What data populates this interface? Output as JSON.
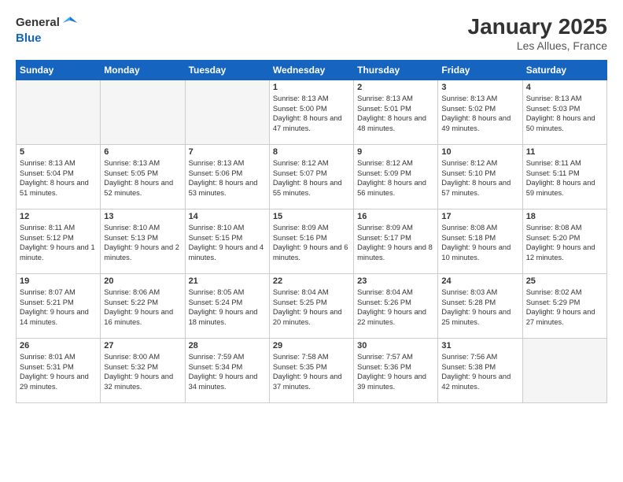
{
  "header": {
    "logo_general": "General",
    "logo_blue": "Blue",
    "month_title": "January 2025",
    "location": "Les Allues, France"
  },
  "weekdays": [
    "Sunday",
    "Monday",
    "Tuesday",
    "Wednesday",
    "Thursday",
    "Friday",
    "Saturday"
  ],
  "weeks": [
    [
      {
        "day": "",
        "text": ""
      },
      {
        "day": "",
        "text": ""
      },
      {
        "day": "",
        "text": ""
      },
      {
        "day": "1",
        "text": "Sunrise: 8:13 AM\nSunset: 5:00 PM\nDaylight: 8 hours and 47 minutes."
      },
      {
        "day": "2",
        "text": "Sunrise: 8:13 AM\nSunset: 5:01 PM\nDaylight: 8 hours and 48 minutes."
      },
      {
        "day": "3",
        "text": "Sunrise: 8:13 AM\nSunset: 5:02 PM\nDaylight: 8 hours and 49 minutes."
      },
      {
        "day": "4",
        "text": "Sunrise: 8:13 AM\nSunset: 5:03 PM\nDaylight: 8 hours and 50 minutes."
      }
    ],
    [
      {
        "day": "5",
        "text": "Sunrise: 8:13 AM\nSunset: 5:04 PM\nDaylight: 8 hours and 51 minutes."
      },
      {
        "day": "6",
        "text": "Sunrise: 8:13 AM\nSunset: 5:05 PM\nDaylight: 8 hours and 52 minutes."
      },
      {
        "day": "7",
        "text": "Sunrise: 8:13 AM\nSunset: 5:06 PM\nDaylight: 8 hours and 53 minutes."
      },
      {
        "day": "8",
        "text": "Sunrise: 8:12 AM\nSunset: 5:07 PM\nDaylight: 8 hours and 55 minutes."
      },
      {
        "day": "9",
        "text": "Sunrise: 8:12 AM\nSunset: 5:09 PM\nDaylight: 8 hours and 56 minutes."
      },
      {
        "day": "10",
        "text": "Sunrise: 8:12 AM\nSunset: 5:10 PM\nDaylight: 8 hours and 57 minutes."
      },
      {
        "day": "11",
        "text": "Sunrise: 8:11 AM\nSunset: 5:11 PM\nDaylight: 8 hours and 59 minutes."
      }
    ],
    [
      {
        "day": "12",
        "text": "Sunrise: 8:11 AM\nSunset: 5:12 PM\nDaylight: 9 hours and 1 minute."
      },
      {
        "day": "13",
        "text": "Sunrise: 8:10 AM\nSunset: 5:13 PM\nDaylight: 9 hours and 2 minutes."
      },
      {
        "day": "14",
        "text": "Sunrise: 8:10 AM\nSunset: 5:15 PM\nDaylight: 9 hours and 4 minutes."
      },
      {
        "day": "15",
        "text": "Sunrise: 8:09 AM\nSunset: 5:16 PM\nDaylight: 9 hours and 6 minutes."
      },
      {
        "day": "16",
        "text": "Sunrise: 8:09 AM\nSunset: 5:17 PM\nDaylight: 9 hours and 8 minutes."
      },
      {
        "day": "17",
        "text": "Sunrise: 8:08 AM\nSunset: 5:18 PM\nDaylight: 9 hours and 10 minutes."
      },
      {
        "day": "18",
        "text": "Sunrise: 8:08 AM\nSunset: 5:20 PM\nDaylight: 9 hours and 12 minutes."
      }
    ],
    [
      {
        "day": "19",
        "text": "Sunrise: 8:07 AM\nSunset: 5:21 PM\nDaylight: 9 hours and 14 minutes."
      },
      {
        "day": "20",
        "text": "Sunrise: 8:06 AM\nSunset: 5:22 PM\nDaylight: 9 hours and 16 minutes."
      },
      {
        "day": "21",
        "text": "Sunrise: 8:05 AM\nSunset: 5:24 PM\nDaylight: 9 hours and 18 minutes."
      },
      {
        "day": "22",
        "text": "Sunrise: 8:04 AM\nSunset: 5:25 PM\nDaylight: 9 hours and 20 minutes."
      },
      {
        "day": "23",
        "text": "Sunrise: 8:04 AM\nSunset: 5:26 PM\nDaylight: 9 hours and 22 minutes."
      },
      {
        "day": "24",
        "text": "Sunrise: 8:03 AM\nSunset: 5:28 PM\nDaylight: 9 hours and 25 minutes."
      },
      {
        "day": "25",
        "text": "Sunrise: 8:02 AM\nSunset: 5:29 PM\nDaylight: 9 hours and 27 minutes."
      }
    ],
    [
      {
        "day": "26",
        "text": "Sunrise: 8:01 AM\nSunset: 5:31 PM\nDaylight: 9 hours and 29 minutes."
      },
      {
        "day": "27",
        "text": "Sunrise: 8:00 AM\nSunset: 5:32 PM\nDaylight: 9 hours and 32 minutes."
      },
      {
        "day": "28",
        "text": "Sunrise: 7:59 AM\nSunset: 5:34 PM\nDaylight: 9 hours and 34 minutes."
      },
      {
        "day": "29",
        "text": "Sunrise: 7:58 AM\nSunset: 5:35 PM\nDaylight: 9 hours and 37 minutes."
      },
      {
        "day": "30",
        "text": "Sunrise: 7:57 AM\nSunset: 5:36 PM\nDaylight: 9 hours and 39 minutes."
      },
      {
        "day": "31",
        "text": "Sunrise: 7:56 AM\nSunset: 5:38 PM\nDaylight: 9 hours and 42 minutes."
      },
      {
        "day": "",
        "text": ""
      }
    ]
  ]
}
